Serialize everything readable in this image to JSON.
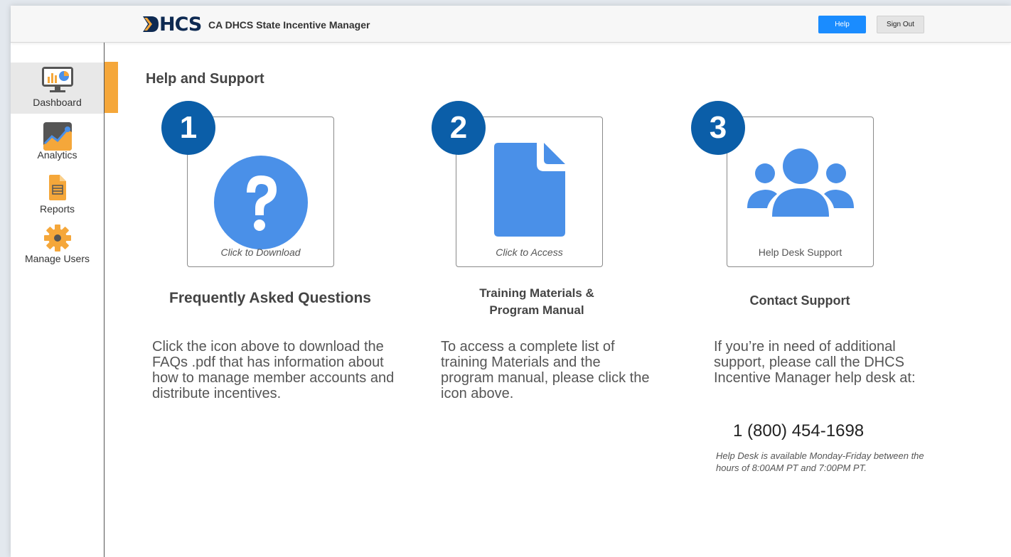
{
  "header": {
    "logo_text": "HCS",
    "app_title": "CA DHCS State Incentive Manager",
    "help_label": "Help",
    "signout_label": "Sign Out"
  },
  "sidebar": {
    "items": [
      {
        "label": "Dashboard",
        "icon": "dashboard-monitor-icon",
        "active": true
      },
      {
        "label": "Analytics",
        "icon": "analytics-chart-icon",
        "active": false
      },
      {
        "label": "Reports",
        "icon": "reports-document-icon",
        "active": false
      },
      {
        "label": "Manage Users",
        "icon": "gear-icon",
        "active": false
      }
    ]
  },
  "main": {
    "page_title": "Help and Support",
    "cards": [
      {
        "number": "1",
        "icon": "question-circle-icon",
        "caption": "Click to Download",
        "title": "Frequently Asked Questions",
        "description": "Click the icon above to download the FAQs .pdf that has information about how to manage member accounts and distribute incentives."
      },
      {
        "number": "2",
        "icon": "document-icon",
        "caption": "Click to Access",
        "title_line1": "Training Materials &",
        "title_line2": "Program Manual",
        "description": "To access a complete list of training Materials and the program manual, please click the icon above."
      },
      {
        "number": "3",
        "icon": "users-group-icon",
        "caption": "Help Desk Support",
        "title": "Contact Support",
        "description": "If you’re in need of additional support, please call the DHCS Incentive Manager help desk at:",
        "phone": "1 (800) 454-1698",
        "hours": "Help Desk is available Monday-Friday between the hours of 8:00AM PT and 7:00PM PT."
      }
    ]
  },
  "colors": {
    "accent_blue": "#1a8cff",
    "icon_blue": "#4a90e8",
    "badge_navy": "#0b5ea8",
    "active_orange": "#f5a73a",
    "logo_navy": "#0e2a52"
  }
}
